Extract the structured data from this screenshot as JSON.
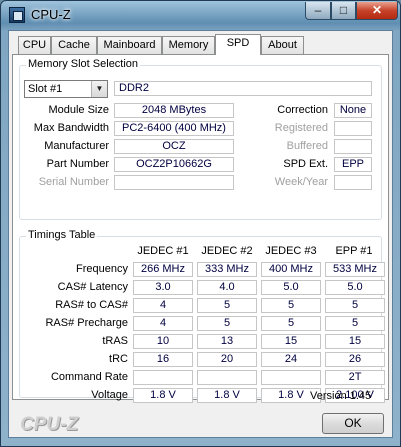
{
  "window": {
    "title": "CPU-Z",
    "controls": {
      "minimize": "–",
      "maximize": "□",
      "close": "✕"
    }
  },
  "tabs": [
    {
      "label": "CPU"
    },
    {
      "label": "Cache"
    },
    {
      "label": "Mainboard"
    },
    {
      "label": "Memory"
    },
    {
      "label": "SPD"
    },
    {
      "label": "About"
    }
  ],
  "active_tab": "SPD",
  "memory_slot": {
    "group_title": "Memory Slot Selection",
    "slot_select": "Slot #1",
    "type": "DDR2",
    "module_size_label": "Module Size",
    "module_size": "2048 MBytes",
    "max_bandwidth_label": "Max Bandwidth",
    "max_bandwidth": "PC2-6400 (400 MHz)",
    "manufacturer_label": "Manufacturer",
    "manufacturer": "OCZ",
    "part_number_label": "Part Number",
    "part_number": "OCZ2P10662G",
    "serial_number_label": "Serial Number",
    "serial_number": "",
    "correction_label": "Correction",
    "correction": "None",
    "registered_label": "Registered",
    "registered": "",
    "buffered_label": "Buffered",
    "buffered": "",
    "spd_ext_label": "SPD Ext.",
    "spd_ext": "EPP",
    "week_year_label": "Week/Year",
    "week_year": ""
  },
  "timings": {
    "group_title": "Timings Table",
    "columns": [
      "JEDEC #1",
      "JEDEC #2",
      "JEDEC #3",
      "EPP #1"
    ],
    "rows": [
      {
        "label": "Frequency",
        "values": [
          "266 MHz",
          "333 MHz",
          "400 MHz",
          "533 MHz"
        ]
      },
      {
        "label": "CAS# Latency",
        "values": [
          "3.0",
          "4.0",
          "5.0",
          "5.0"
        ]
      },
      {
        "label": "RAS# to CAS#",
        "values": [
          "4",
          "5",
          "5",
          "5"
        ]
      },
      {
        "label": "RAS# Precharge",
        "values": [
          "4",
          "5",
          "5",
          "5"
        ]
      },
      {
        "label": "tRAS",
        "values": [
          "10",
          "13",
          "15",
          "15"
        ]
      },
      {
        "label": "tRC",
        "values": [
          "16",
          "20",
          "24",
          "26"
        ]
      },
      {
        "label": "Command Rate",
        "values": [
          "",
          "",
          "",
          "2T"
        ]
      },
      {
        "label": "Voltage",
        "values": [
          "1.8 V",
          "1.8 V",
          "1.8 V",
          "2.100 V"
        ]
      }
    ]
  },
  "footer": {
    "version": "Version 1.45",
    "logo": "CPU-Z",
    "ok_label": "OK"
  }
}
